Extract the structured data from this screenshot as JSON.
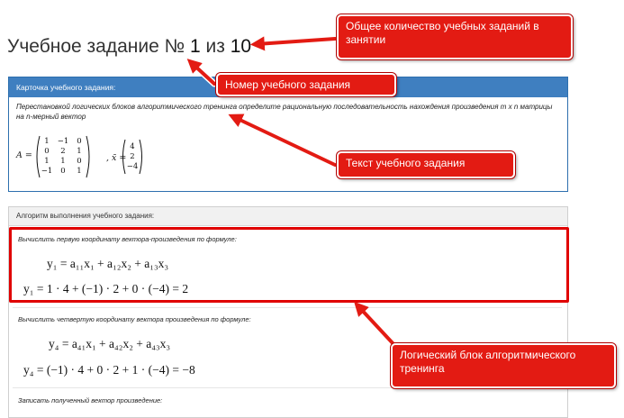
{
  "header": {
    "title_prefix": "Учебное задание № ",
    "task_number": "1",
    "title_middle": " из ",
    "task_total": "10"
  },
  "task_card": {
    "heading": "Карточка учебного задания:",
    "description": "Перестановкой логических блоков алгоритмического тренинга определите рациональную последовательность нахождения произведения m x n матрицы на n-мерный вектор",
    "matrix_label": "A =",
    "matrix": [
      [
        "1",
        "−1",
        "0"
      ],
      [
        "0",
        "2",
        "1"
      ],
      [
        "1",
        "1",
        "0"
      ],
      [
        "−1",
        "0",
        "1"
      ]
    ],
    "vector_label": ", x̄ =",
    "vector": [
      "4",
      "2",
      "−4"
    ]
  },
  "algorithm": {
    "heading": "Алгоритм выполнения учебного задания:",
    "steps": [
      {
        "label": "Вычислить первую координату вектора-произведения по формуле:",
        "formula": "y₁ = a₁₁x₁ + a₁₂x₂ + a₁₃x₃",
        "computation": "y₁ = 1 · 4 + (−1) · 2 + 0 · (−4) = 2"
      },
      {
        "label": "Вычислить четвертую координату вектора произведения по формуле:",
        "formula": "y₄ = a₄₁x₁ + a₄₂x₂ + a₄₃x₃",
        "computation": "y₄ = (−1) · 4 + 0 · 2 + 1 · (−4) = −8"
      },
      {
        "label": "Записать полученный вектор произведение:"
      }
    ]
  },
  "callouts": {
    "total_tasks": "Общее количество учебных заданий в занятии",
    "task_number": "Номер учебного задания",
    "task_text": "Текст учебного задания",
    "logic_block": "Логический блок алгоритмического тренинга"
  },
  "colors": {
    "callout": "#e31b13",
    "card_header": "#3f7fc0",
    "highlight": "#e00000"
  }
}
